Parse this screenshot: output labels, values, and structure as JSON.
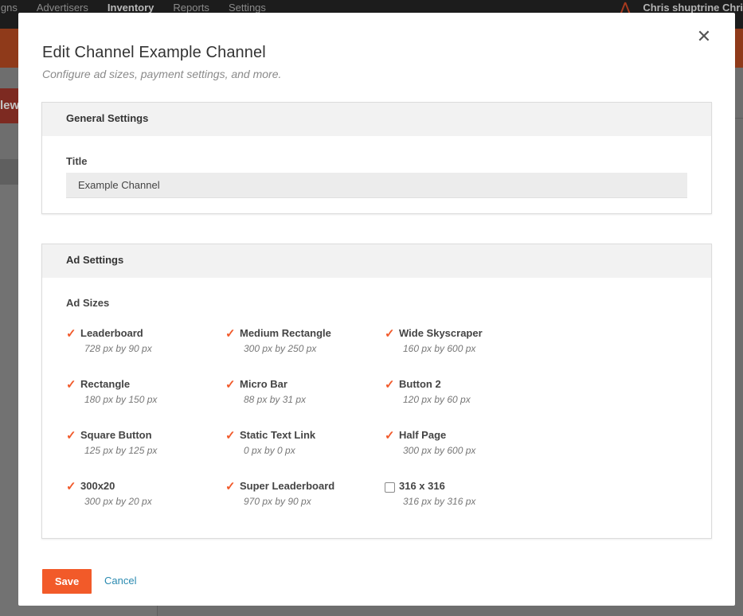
{
  "app": {
    "nav": [
      "igns",
      "Advertisers",
      "Inventory",
      "Reports",
      "Settings"
    ],
    "active_nav": "Inventory",
    "user_name": "Chris shuptrine Chri",
    "logo_glyph": "⋀",
    "new_button_fragment": "lew"
  },
  "modal": {
    "title": "Edit Channel Example Channel",
    "subtitle": "Configure ad sizes, payment settings, and more.",
    "close_glyph": "✕",
    "general": {
      "heading": "General Settings",
      "title_label": "Title",
      "title_value": "Example Channel"
    },
    "ads": {
      "heading": "Ad Settings",
      "sizes_label": "Ad Sizes",
      "sizes": [
        {
          "name": "Leaderboard",
          "dims": "728 px by 90 px",
          "checked": true
        },
        {
          "name": "Medium Rectangle",
          "dims": "300 px by 250 px",
          "checked": true
        },
        {
          "name": "Wide Skyscraper",
          "dims": "160 px by 600 px",
          "checked": true
        },
        {
          "name": "Rectangle",
          "dims": "180 px by 150 px",
          "checked": true
        },
        {
          "name": "Micro Bar",
          "dims": "88 px by 31 px",
          "checked": true
        },
        {
          "name": "Button 2",
          "dims": "120 px by 60 px",
          "checked": true
        },
        {
          "name": "Square Button",
          "dims": "125 px by 125 px",
          "checked": true
        },
        {
          "name": "Static Text Link",
          "dims": "0 px by 0 px",
          "checked": true
        },
        {
          "name": "Half Page",
          "dims": "300 px by 600 px",
          "checked": true
        },
        {
          "name": "300x20",
          "dims": "300 px by 20 px",
          "checked": true
        },
        {
          "name": "Super Leaderboard",
          "dims": "970 px by 90 px",
          "checked": true
        },
        {
          "name": "316 x 316",
          "dims": "316 px by 316 px",
          "checked": false
        }
      ]
    },
    "save_label": "Save",
    "cancel_label": "Cancel"
  },
  "colors": {
    "accent": "#f25a29",
    "link": "#2a8ab0",
    "check": "#f15a2b"
  }
}
